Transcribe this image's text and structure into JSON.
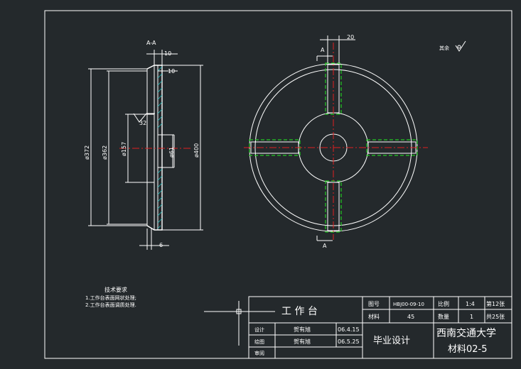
{
  "section": {
    "label": "A-A",
    "dims": {
      "d372": "ø372",
      "d362": "ø362",
      "d157": "ø157",
      "d61": "ø61",
      "d400": "ø400",
      "top10a": "10",
      "top10b": "10",
      "bottom6": "6",
      "rough": "32"
    }
  },
  "front": {
    "dim20": "20",
    "cut_top": "A",
    "cut_bottom": "A",
    "rest_note": "其余"
  },
  "notes": {
    "title": "技术要求",
    "items": [
      "1.工作台表面网状处理;",
      "2.工作台表面调质处理."
    ]
  },
  "title_block": {
    "part_name": "工 作 台",
    "drawing_no_label": "图号",
    "drawing_no": "HBJ00-09-10",
    "scale_label": "比例",
    "scale": "1:4",
    "sheet": "第12张",
    "material_label": "材料",
    "material": "45",
    "qty_label": "数量",
    "qty": "1",
    "total_sheets": "共25张",
    "design_label": "设计",
    "design_name": "贺有旭",
    "design_date": "06.4.15",
    "draw_label": "绘图",
    "draw_name": "贺有旭",
    "draw_date": "06.5.25",
    "review_label": "审阅",
    "project": "毕业设计",
    "school": "西南交通大学",
    "class": "材料02-5"
  }
}
